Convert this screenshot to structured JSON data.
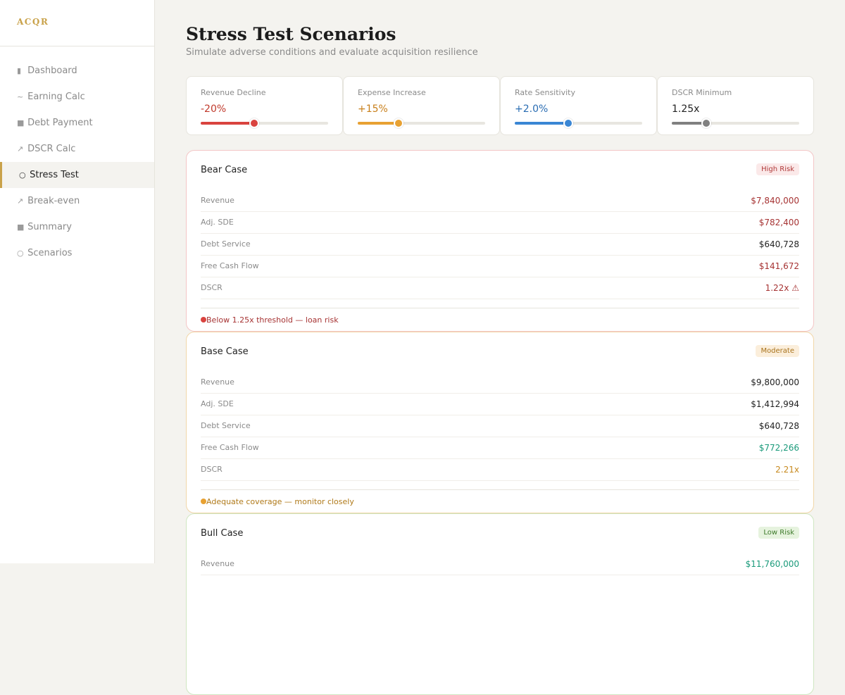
{
  "app": {
    "logo": "ACQR"
  },
  "sidebar": {
    "items": [
      {
        "icon": "▮",
        "label": "Dashboard",
        "active": false
      },
      {
        "icon": "~",
        "label": "Earning Calc",
        "active": false
      },
      {
        "icon": "■",
        "label": "Debt Payment",
        "active": false
      },
      {
        "icon": "↗",
        "label": "DSCR Calc",
        "active": false
      },
      {
        "icon": "○",
        "label": "Stress Test",
        "active": true
      },
      {
        "icon": "↗",
        "label": "Break-even",
        "active": false
      },
      {
        "icon": "■",
        "label": "Summary",
        "active": false
      },
      {
        "icon": "○",
        "label": "Scenarios",
        "active": false
      }
    ]
  },
  "page": {
    "title": "Stress Test Scenarios",
    "subtitle": "Simulate adverse conditions and evaluate acquisition resilience"
  },
  "sliders": [
    {
      "label": "Revenue Decline",
      "value": "-20%",
      "fraction": 0.42,
      "color": "#d9433f",
      "value_color": "#c0392b"
    },
    {
      "label": "Expense Increase",
      "value": "+15%",
      "fraction": 0.32,
      "color": "#e8a132",
      "value_color": "#c87f1a"
    },
    {
      "label": "Rate Sensitivity",
      "value": "+2.0%",
      "fraction": 0.42,
      "color": "#3a86d4",
      "value_color": "#2a6db3"
    },
    {
      "label": "DSCR Minimum",
      "value": "1.25x",
      "fraction": 0.27,
      "color": "#808080",
      "value_color": "#222222"
    }
  ],
  "scenarios": [
    {
      "name": "Bear Case",
      "badge": "High Risk",
      "badge_bg": "#fbe9e9",
      "badge_color": "#b03a3a",
      "border": "#f3c6c6",
      "rows": [
        {
          "label": "Revenue",
          "value": "$7,840,000",
          "color": "#a63333"
        },
        {
          "label": "Adj. SDE",
          "value": "$782,400",
          "color": "#a63333"
        },
        {
          "label": "Debt Service",
          "value": "$640,728",
          "color": "#222222"
        },
        {
          "label": "Free Cash Flow",
          "value": "$141,672",
          "color": "#a63333"
        },
        {
          "label": "DSCR",
          "value": "1.22x ⚠",
          "color": "#a63333"
        }
      ],
      "note": "Below 1.25x threshold — loan risk",
      "note_color": "#a63333",
      "dot_color": "#d9433f"
    },
    {
      "name": "Base Case",
      "badge": "Moderate",
      "badge_bg": "#fbeedb",
      "badge_color": "#a8731c",
      "border": "#f1d6a8",
      "rows": [
        {
          "label": "Revenue",
          "value": "$9,800,000",
          "color": "#222222"
        },
        {
          "label": "Adj. SDE",
          "value": "$1,412,994",
          "color": "#222222"
        },
        {
          "label": "Debt Service",
          "value": "$640,728",
          "color": "#222222"
        },
        {
          "label": "Free Cash Flow",
          "value": "$772,266",
          "color": "#1a9a7a"
        },
        {
          "label": "DSCR",
          "value": "2.21x",
          "color": "#c78a1f"
        }
      ],
      "note": "Adequate coverage — monitor closely",
      "note_color": "#b07a1a",
      "dot_color": "#e8a132"
    },
    {
      "name": "Bull Case",
      "badge": "Low Risk",
      "badge_bg": "#e6f3de",
      "badge_color": "#3d7a2a",
      "border": "#cfe6c1",
      "rows": [
        {
          "label": "Revenue",
          "value": "$11,760,000",
          "color": "#1a9a7a"
        }
      ],
      "note": "",
      "note_color": "#3d7a2a",
      "dot_color": "#5aa83a"
    }
  ]
}
